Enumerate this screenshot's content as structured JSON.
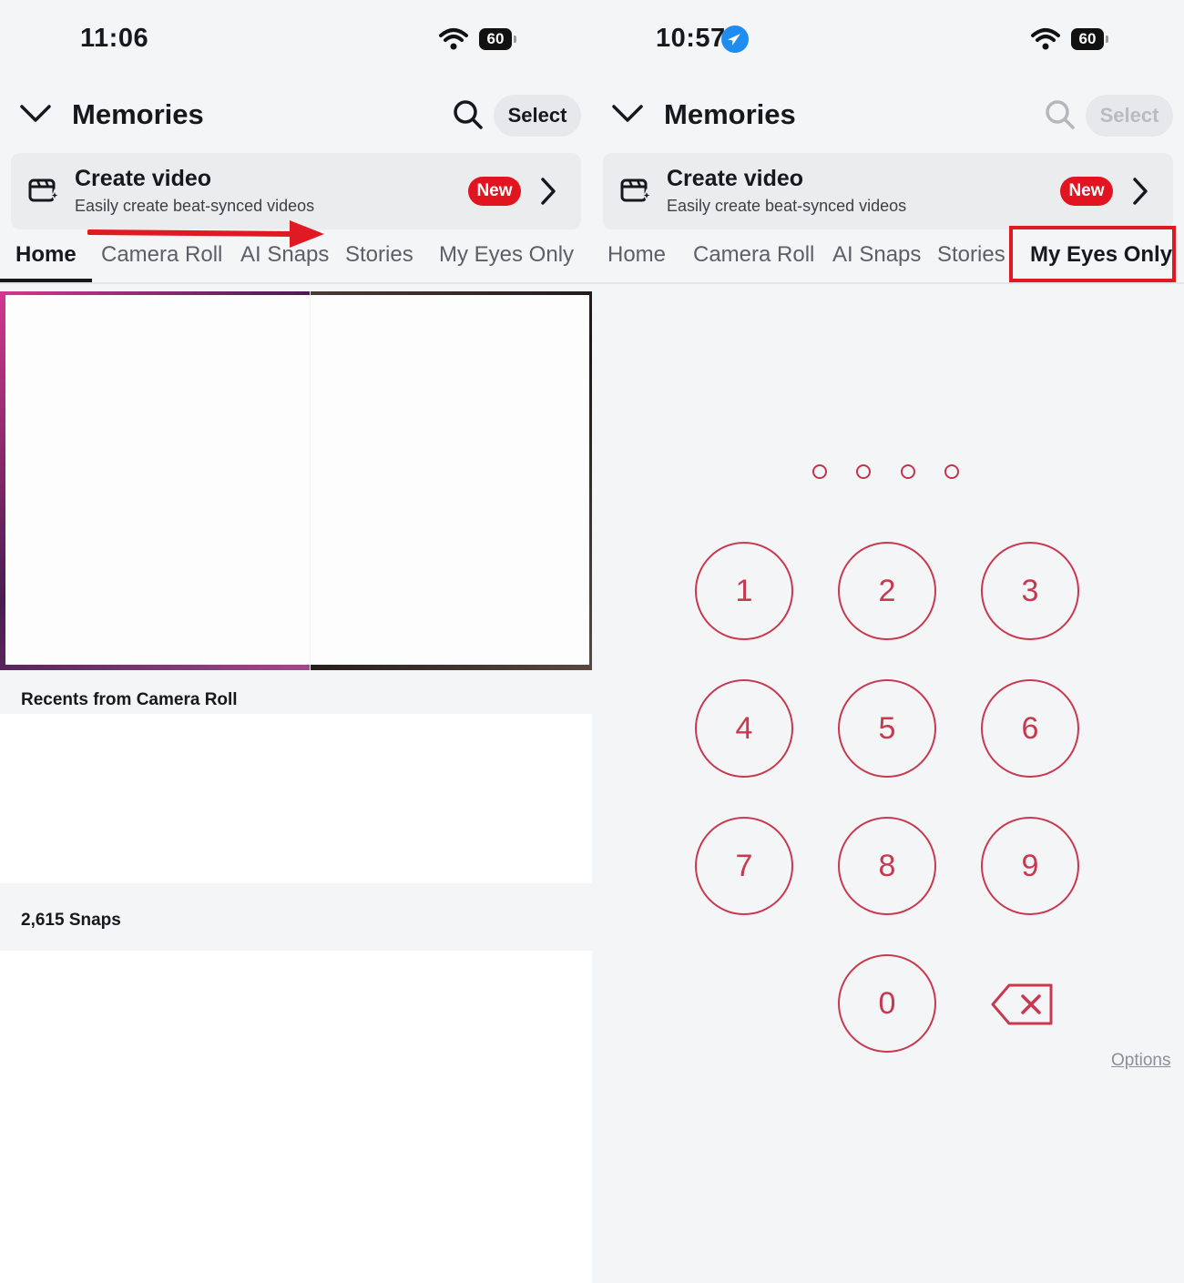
{
  "left": {
    "status": {
      "time": "11:06",
      "battery": "60"
    },
    "header": {
      "title": "Memories",
      "select_label": "Select"
    },
    "card": {
      "title": "Create video",
      "subtitle": "Easily create beat-synced videos",
      "badge": "New"
    },
    "tabs": [
      "Home",
      "Camera Roll",
      "AI Snaps",
      "Stories",
      "My Eyes Only"
    ],
    "active_tab": "Home",
    "sections": {
      "recents": "Recents from Camera Roll",
      "snaps_count": "2,615 Snaps"
    }
  },
  "right": {
    "status": {
      "time": "10:57",
      "battery": "60"
    },
    "header": {
      "title": "Memories",
      "select_label": "Select"
    },
    "card": {
      "title": "Create video",
      "subtitle": "Easily create beat-synced videos",
      "badge": "New"
    },
    "tabs": [
      "Home",
      "Camera Roll",
      "AI Snaps",
      "Stories",
      "My Eyes Only"
    ],
    "active_tab": "My Eyes Only",
    "keypad": {
      "keys": [
        "1",
        "2",
        "3",
        "4",
        "5",
        "6",
        "7",
        "8",
        "9",
        "0"
      ],
      "options_label": "Options",
      "pin_length": 4
    }
  },
  "icons": [
    "chevron-down-icon",
    "search-icon",
    "video-sparkle-icon",
    "chevron-right-icon",
    "wifi-icon",
    "battery-icon",
    "location-arrow-icon",
    "backspace-icon"
  ],
  "colors": {
    "accent_red": "#e1141f",
    "keypad": "#c8394f",
    "annotation": "#e01a22"
  }
}
